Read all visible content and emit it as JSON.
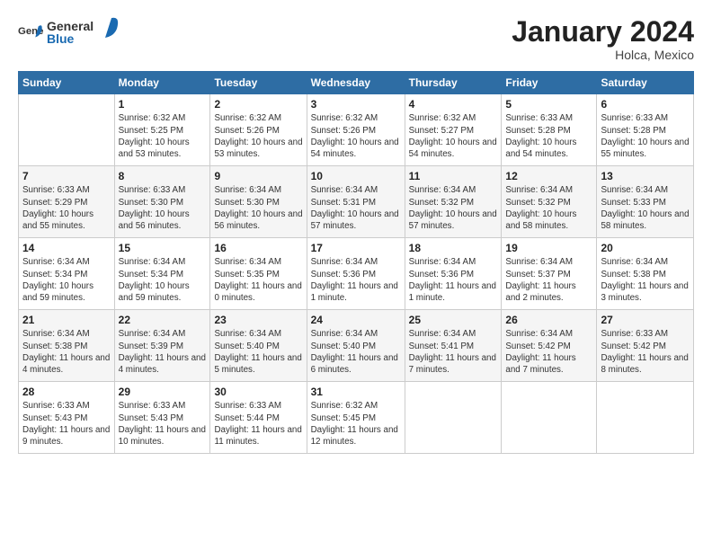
{
  "logo": {
    "general": "General",
    "blue": "Blue"
  },
  "title": "January 2024",
  "location": "Holca, Mexico",
  "weekdays": [
    "Sunday",
    "Monday",
    "Tuesday",
    "Wednesday",
    "Thursday",
    "Friday",
    "Saturday"
  ],
  "weeks": [
    [
      {
        "day": "",
        "sunrise": "",
        "sunset": "",
        "daylight": ""
      },
      {
        "day": "1",
        "sunrise": "Sunrise: 6:32 AM",
        "sunset": "Sunset: 5:25 PM",
        "daylight": "Daylight: 10 hours and 53 minutes."
      },
      {
        "day": "2",
        "sunrise": "Sunrise: 6:32 AM",
        "sunset": "Sunset: 5:26 PM",
        "daylight": "Daylight: 10 hours and 53 minutes."
      },
      {
        "day": "3",
        "sunrise": "Sunrise: 6:32 AM",
        "sunset": "Sunset: 5:26 PM",
        "daylight": "Daylight: 10 hours and 54 minutes."
      },
      {
        "day": "4",
        "sunrise": "Sunrise: 6:32 AM",
        "sunset": "Sunset: 5:27 PM",
        "daylight": "Daylight: 10 hours and 54 minutes."
      },
      {
        "day": "5",
        "sunrise": "Sunrise: 6:33 AM",
        "sunset": "Sunset: 5:28 PM",
        "daylight": "Daylight: 10 hours and 54 minutes."
      },
      {
        "day": "6",
        "sunrise": "Sunrise: 6:33 AM",
        "sunset": "Sunset: 5:28 PM",
        "daylight": "Daylight: 10 hours and 55 minutes."
      }
    ],
    [
      {
        "day": "7",
        "sunrise": "Sunrise: 6:33 AM",
        "sunset": "Sunset: 5:29 PM",
        "daylight": "Daylight: 10 hours and 55 minutes."
      },
      {
        "day": "8",
        "sunrise": "Sunrise: 6:33 AM",
        "sunset": "Sunset: 5:30 PM",
        "daylight": "Daylight: 10 hours and 56 minutes."
      },
      {
        "day": "9",
        "sunrise": "Sunrise: 6:34 AM",
        "sunset": "Sunset: 5:30 PM",
        "daylight": "Daylight: 10 hours and 56 minutes."
      },
      {
        "day": "10",
        "sunrise": "Sunrise: 6:34 AM",
        "sunset": "Sunset: 5:31 PM",
        "daylight": "Daylight: 10 hours and 57 minutes."
      },
      {
        "day": "11",
        "sunrise": "Sunrise: 6:34 AM",
        "sunset": "Sunset: 5:32 PM",
        "daylight": "Daylight: 10 hours and 57 minutes."
      },
      {
        "day": "12",
        "sunrise": "Sunrise: 6:34 AM",
        "sunset": "Sunset: 5:32 PM",
        "daylight": "Daylight: 10 hours and 58 minutes."
      },
      {
        "day": "13",
        "sunrise": "Sunrise: 6:34 AM",
        "sunset": "Sunset: 5:33 PM",
        "daylight": "Daylight: 10 hours and 58 minutes."
      }
    ],
    [
      {
        "day": "14",
        "sunrise": "Sunrise: 6:34 AM",
        "sunset": "Sunset: 5:34 PM",
        "daylight": "Daylight: 10 hours and 59 minutes."
      },
      {
        "day": "15",
        "sunrise": "Sunrise: 6:34 AM",
        "sunset": "Sunset: 5:34 PM",
        "daylight": "Daylight: 10 hours and 59 minutes."
      },
      {
        "day": "16",
        "sunrise": "Sunrise: 6:34 AM",
        "sunset": "Sunset: 5:35 PM",
        "daylight": "Daylight: 11 hours and 0 minutes."
      },
      {
        "day": "17",
        "sunrise": "Sunrise: 6:34 AM",
        "sunset": "Sunset: 5:36 PM",
        "daylight": "Daylight: 11 hours and 1 minute."
      },
      {
        "day": "18",
        "sunrise": "Sunrise: 6:34 AM",
        "sunset": "Sunset: 5:36 PM",
        "daylight": "Daylight: 11 hours and 1 minute."
      },
      {
        "day": "19",
        "sunrise": "Sunrise: 6:34 AM",
        "sunset": "Sunset: 5:37 PM",
        "daylight": "Daylight: 11 hours and 2 minutes."
      },
      {
        "day": "20",
        "sunrise": "Sunrise: 6:34 AM",
        "sunset": "Sunset: 5:38 PM",
        "daylight": "Daylight: 11 hours and 3 minutes."
      }
    ],
    [
      {
        "day": "21",
        "sunrise": "Sunrise: 6:34 AM",
        "sunset": "Sunset: 5:38 PM",
        "daylight": "Daylight: 11 hours and 4 minutes."
      },
      {
        "day": "22",
        "sunrise": "Sunrise: 6:34 AM",
        "sunset": "Sunset: 5:39 PM",
        "daylight": "Daylight: 11 hours and 4 minutes."
      },
      {
        "day": "23",
        "sunrise": "Sunrise: 6:34 AM",
        "sunset": "Sunset: 5:40 PM",
        "daylight": "Daylight: 11 hours and 5 minutes."
      },
      {
        "day": "24",
        "sunrise": "Sunrise: 6:34 AM",
        "sunset": "Sunset: 5:40 PM",
        "daylight": "Daylight: 11 hours and 6 minutes."
      },
      {
        "day": "25",
        "sunrise": "Sunrise: 6:34 AM",
        "sunset": "Sunset: 5:41 PM",
        "daylight": "Daylight: 11 hours and 7 minutes."
      },
      {
        "day": "26",
        "sunrise": "Sunrise: 6:34 AM",
        "sunset": "Sunset: 5:42 PM",
        "daylight": "Daylight: 11 hours and 7 minutes."
      },
      {
        "day": "27",
        "sunrise": "Sunrise: 6:33 AM",
        "sunset": "Sunset: 5:42 PM",
        "daylight": "Daylight: 11 hours and 8 minutes."
      }
    ],
    [
      {
        "day": "28",
        "sunrise": "Sunrise: 6:33 AM",
        "sunset": "Sunset: 5:43 PM",
        "daylight": "Daylight: 11 hours and 9 minutes."
      },
      {
        "day": "29",
        "sunrise": "Sunrise: 6:33 AM",
        "sunset": "Sunset: 5:43 PM",
        "daylight": "Daylight: 11 hours and 10 minutes."
      },
      {
        "day": "30",
        "sunrise": "Sunrise: 6:33 AM",
        "sunset": "Sunset: 5:44 PM",
        "daylight": "Daylight: 11 hours and 11 minutes."
      },
      {
        "day": "31",
        "sunrise": "Sunrise: 6:32 AM",
        "sunset": "Sunset: 5:45 PM",
        "daylight": "Daylight: 11 hours and 12 minutes."
      },
      {
        "day": "",
        "sunrise": "",
        "sunset": "",
        "daylight": ""
      },
      {
        "day": "",
        "sunrise": "",
        "sunset": "",
        "daylight": ""
      },
      {
        "day": "",
        "sunrise": "",
        "sunset": "",
        "daylight": ""
      }
    ]
  ]
}
